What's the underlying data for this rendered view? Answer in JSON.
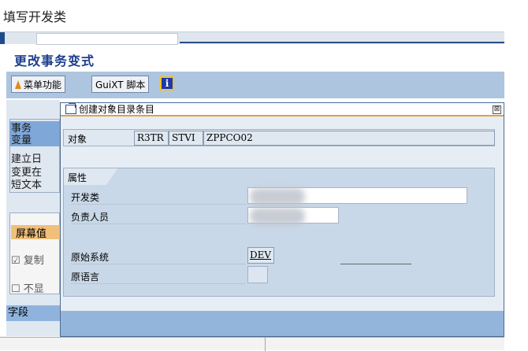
{
  "heading": "填写开发类",
  "transaction_title": "更改事务变式",
  "toolbar": {
    "menu_label": "菜单功能",
    "guixt_label": "GuiXT 脚本",
    "info_label": "i"
  },
  "left_panel": {
    "labels": [
      "事务",
      "变量",
      "建立日",
      "变更在",
      "短文本"
    ],
    "screen_values": "屏幕值",
    "checkbox_copy": "复制",
    "checkbox_hide": "不显",
    "fields": "字段"
  },
  "dialog": {
    "title": "创建对象目录条目",
    "close_glyph": "⊠",
    "object_label": "对象",
    "object_values": [
      "R3TR",
      "STVI",
      "ZPPCO02"
    ],
    "group_title": "属性",
    "dev_class_label": "开发类",
    "dev_class_value": "",
    "responsible_label": "负责人员",
    "responsible_value": "",
    "orig_system_label": "原始系统",
    "orig_system_value": "DEV",
    "orig_lang_label": "原语言",
    "orig_lang_value": ""
  },
  "colors": {
    "sap_blue": "#aec5e0",
    "title_blue": "#1c3f8f",
    "dialog_bg": "#e6edf4",
    "accent_orange": "#e2a04b"
  }
}
